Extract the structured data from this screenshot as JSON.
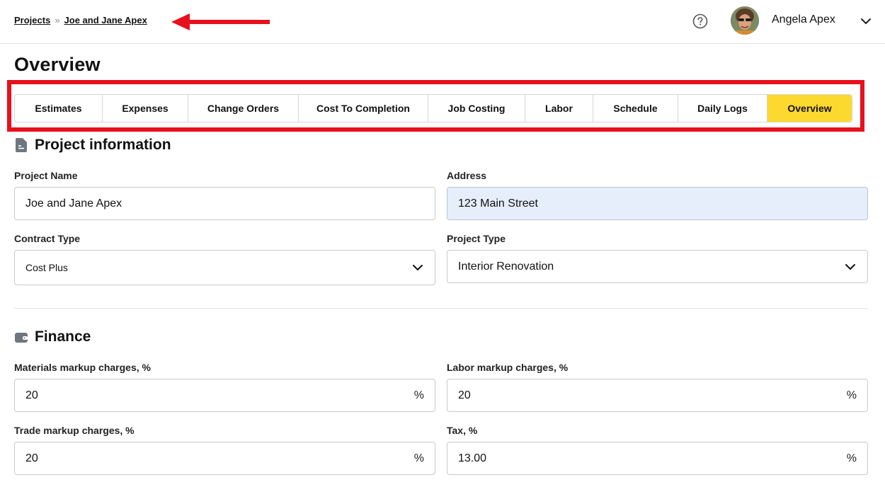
{
  "breadcrumb": {
    "projects": "Projects",
    "separator": "»",
    "current": "Joe and Jane Apex"
  },
  "user": {
    "name": "Angela Apex"
  },
  "icons": {
    "help": "help-circle-icon",
    "user_menu": "chevron-down-icon",
    "project_info": "document-icon",
    "finance": "wallet-icon",
    "select": "chevron-down-icon"
  },
  "page": {
    "title": "Overview"
  },
  "tabs": [
    {
      "label": "Estimates",
      "active": false
    },
    {
      "label": "Expenses",
      "active": false
    },
    {
      "label": "Change Orders",
      "active": false
    },
    {
      "label": "Cost To Completion",
      "active": false
    },
    {
      "label": "Job Costing",
      "active": false
    },
    {
      "label": "Labor",
      "active": false
    },
    {
      "label": "Schedule",
      "active": false
    },
    {
      "label": "Daily Logs",
      "active": false
    },
    {
      "label": "Overview",
      "active": true
    }
  ],
  "project_info": {
    "title": "Project information",
    "project_name": {
      "label": "Project Name",
      "value": "Joe and Jane Apex"
    },
    "address": {
      "label": "Address",
      "value": "123 Main Street"
    },
    "contract_type": {
      "label": "Contract Type",
      "value": "Cost Plus"
    },
    "project_type": {
      "label": "Project Type",
      "value": "Interior Renovation"
    }
  },
  "finance": {
    "title": "Finance",
    "materials_markup": {
      "label": "Materials markup charges, %",
      "value": "20",
      "suffix": "%"
    },
    "labor_markup": {
      "label": "Labor markup charges, %",
      "value": "20",
      "suffix": "%"
    },
    "trade_markup": {
      "label": "Trade markup charges, %",
      "value": "20",
      "suffix": "%"
    },
    "tax": {
      "label": "Tax, %",
      "value": "13.00",
      "suffix": "%"
    }
  },
  "colors": {
    "accent_yellow": "#fcd92f",
    "annotation_red": "#e8101c",
    "address_bg": "#e6eefc"
  }
}
